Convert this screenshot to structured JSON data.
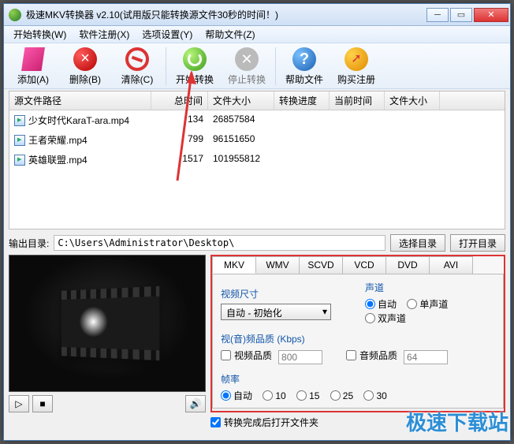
{
  "title": "极速MKV转换器 v2.10(试用版只能转换源文件30秒的时间！)",
  "menus": {
    "start": "开始转换(W)",
    "register": "软件注册(X)",
    "options": "选项设置(Y)",
    "help": "帮助文件(Z)"
  },
  "toolbar": {
    "add": "添加(A)",
    "delete": "删除(B)",
    "clear": "清除(C)",
    "start": "开始转换",
    "stop": "停止转换",
    "help": "帮助文件",
    "buy": "购买注册"
  },
  "list": {
    "headers": {
      "path": "源文件路径",
      "time": "总时间",
      "size": "文件大小",
      "progress": "转换进度",
      "current": "当前时间",
      "fsize": "文件大小"
    },
    "rows": [
      {
        "name": "少女时代KaraT-ara.mp4",
        "time": "134",
        "size": "26857584"
      },
      {
        "name": "王者荣耀.mp4",
        "time": "799",
        "size": "96151650"
      },
      {
        "name": "英雄联盟.mp4",
        "time": "1517",
        "size": "101955812"
      }
    ]
  },
  "output": {
    "label": "输出目录:",
    "path": "C:\\Users\\Administrator\\Desktop\\",
    "select_btn": "选择目录",
    "open_btn": "打开目录"
  },
  "tabs": [
    "MKV",
    "WMV",
    "SCVD",
    "VCD",
    "DVD",
    "AVI"
  ],
  "form": {
    "video_size_lbl": "视频尺寸",
    "video_size_val": "自动 - 初始化",
    "audio_lbl": "声道",
    "audio_auto": "自动",
    "audio_mono": "单声道",
    "audio_stereo": "双声道",
    "quality_lbl": "视(音)频品质 (Kbps)",
    "video_q": "视频品质",
    "video_q_val": "800",
    "audio_q": "音频品质",
    "audio_q_val": "64",
    "fps_lbl": "帧率",
    "fps_auto": "自动",
    "fps_10": "10",
    "fps_15": "15",
    "fps_25": "25",
    "fps_30": "30"
  },
  "bottom": {
    "open_after": "转换完成后打开文件夹"
  },
  "watermark": "极速下载站"
}
